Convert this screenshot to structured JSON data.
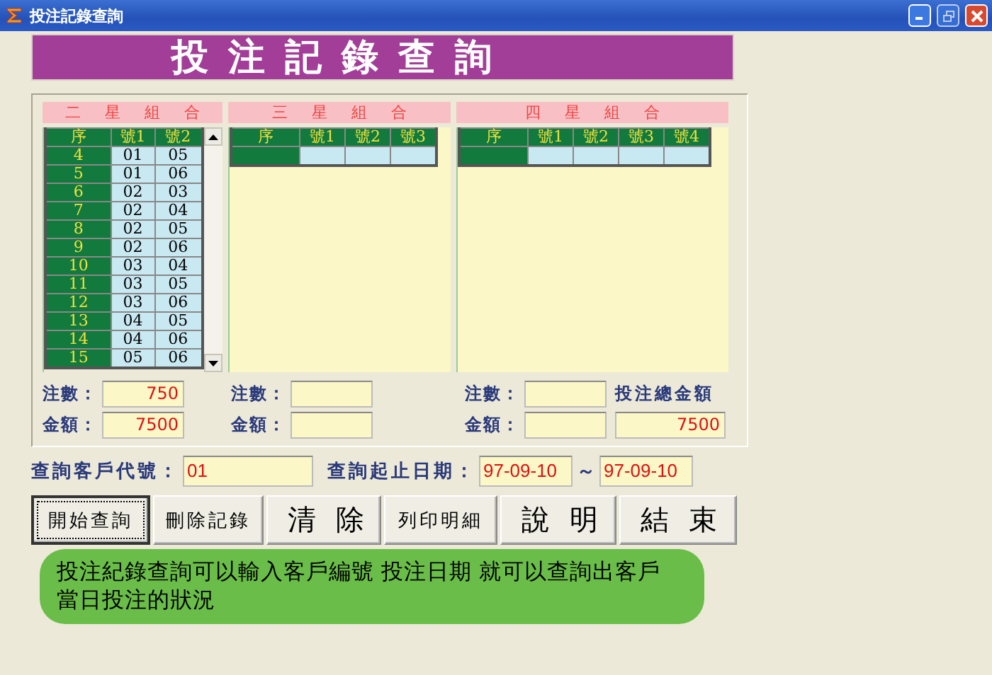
{
  "window": {
    "title": "投注記錄查詢"
  },
  "banner": {
    "title": "投注記錄查詢"
  },
  "groups": [
    {
      "title": "二星組合",
      "columns": [
        "序",
        "號1",
        "號2"
      ],
      "scrollbar": true,
      "rows": [
        [
          "4",
          "01",
          "05"
        ],
        [
          "5",
          "01",
          "06"
        ],
        [
          "6",
          "02",
          "03"
        ],
        [
          "7",
          "02",
          "04"
        ],
        [
          "8",
          "02",
          "05"
        ],
        [
          "9",
          "02",
          "06"
        ],
        [
          "10",
          "03",
          "04"
        ],
        [
          "11",
          "03",
          "05"
        ],
        [
          "12",
          "03",
          "06"
        ],
        [
          "13",
          "04",
          "05"
        ],
        [
          "14",
          "04",
          "06"
        ],
        [
          "15",
          "05",
          "06"
        ]
      ],
      "count_label": "注數：",
      "count": "750",
      "amount_label": "金額：",
      "amount": "7500"
    },
    {
      "title": "三星組合",
      "columns": [
        "序",
        "號1",
        "號2",
        "號3"
      ],
      "new_row": true,
      "count_label": "注數：",
      "amount_label": "金額："
    },
    {
      "title": "四星組合",
      "columns": [
        "序",
        "號1",
        "號2",
        "號3",
        "號4"
      ],
      "new_row": true,
      "count_label": "注數：",
      "amount_label": "金額："
    }
  ],
  "grand_total": {
    "label": "投注總金額",
    "value": "7500"
  },
  "query": {
    "customer_label": "查詢客戶代號：",
    "customer": "01",
    "date_label": "查詢起止日期：",
    "date_from": "97-09-10",
    "separator": "～",
    "date_to": "97-09-10"
  },
  "buttons": [
    {
      "label": "開始查詢",
      "kind": "small",
      "focused": true
    },
    {
      "label": "刪除記錄",
      "kind": "small",
      "focused": false
    },
    {
      "label": "清除",
      "kind": "big",
      "focused": false
    },
    {
      "label": "列印明細",
      "kind": "small",
      "focused": false
    },
    {
      "label": "說明",
      "kind": "big",
      "focused": false
    },
    {
      "label": "結束",
      "kind": "big",
      "focused": false
    }
  ],
  "message": "投注紀錄查詢可以輸入客戶編號 投注日期 就可以查詢出客戶當日投注的狀況"
}
